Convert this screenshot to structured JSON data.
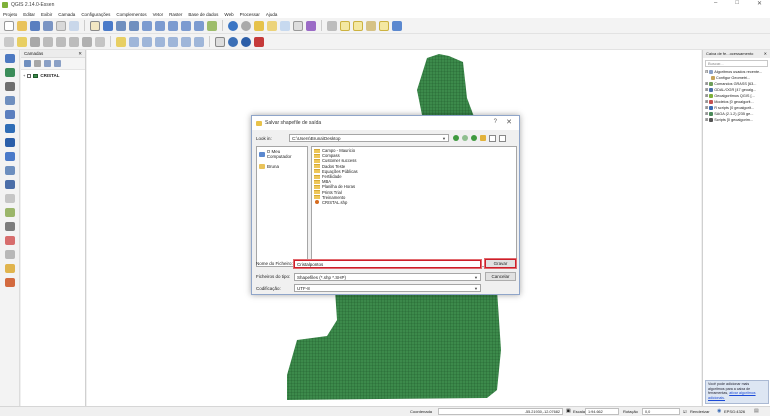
{
  "window": {
    "title": "QGIS 2.14.0-Essen",
    "controls": [
      "–",
      "□",
      "✕"
    ]
  },
  "menu": [
    "Projeto",
    "Editar",
    "Exibir",
    "Camada",
    "Configurações",
    "Complementos",
    "Vetor",
    "Raster",
    "Base de dados",
    "Web",
    "Processar",
    "Ajuda"
  ],
  "layers_panel": {
    "title": "Camadas",
    "layers": [
      {
        "name": "CRISTAL"
      }
    ]
  },
  "toolbox": {
    "title": "Caixa de fe...ocessamento",
    "search_placeholder": "Buscar...",
    "items": [
      "Algoritmos usados recente...",
      "Configur Geometri...",
      "Comandos GRASS [63...",
      "GDAL/OGR [47 geoalg...",
      "Geoalgoritmos QGIS [...",
      "Modelos [0 geoalgorit...",
      "R scripts [0 geoalgorit...",
      "SAGA (2.1.2) [235 ge...",
      "Scripts [0 geoalgorim..."
    ],
    "note_text": "Você pode adicionar mais algoritmos para a caixa de ferramentas,",
    "note_link": "ativar algoritmos adicionais."
  },
  "dialog": {
    "title": "Salvar shapefile de saída",
    "help_glyph": "?",
    "close_glyph": "✕",
    "lookin_label": "Look in:",
    "lookin_path": "C:\\Users\\Bruna\\Desktop",
    "sidebar": [
      {
        "label": "O Meu Computador"
      },
      {
        "label": "Bruna"
      }
    ],
    "entries": [
      {
        "name": "Campo - Mauricio",
        "kind": "folder"
      },
      {
        "name": "Compass",
        "kind": "folder"
      },
      {
        "name": "Customer success",
        "kind": "folder"
      },
      {
        "name": "Dados Teste",
        "kind": "folder"
      },
      {
        "name": "Equações Públicas",
        "kind": "folder"
      },
      {
        "name": "Fertilidade",
        "kind": "folder"
      },
      {
        "name": "MBA",
        "kind": "folder"
      },
      {
        "name": "Planilha de Horas",
        "kind": "folder"
      },
      {
        "name": "Prints Trial",
        "kind": "folder"
      },
      {
        "name": "Treinamento",
        "kind": "folder"
      },
      {
        "name": "CRISTAL.shp",
        "kind": "file"
      }
    ],
    "filename_label": "Nome do Ficheiro:",
    "filename_value": "Cristalpontos",
    "save_button": "Gravar",
    "filetype_label": "Ficheiros do tipo:",
    "filetype_value": "Shapefiles (*.shp *.SHP)",
    "cancel_button": "Cancelar",
    "encoding_label": "Codificação:",
    "encoding_value": "UTF-8"
  },
  "statusbar": {
    "coord_label": "Coordenada",
    "coord_value": "-55.21930,-12.07682",
    "scale_label": "Escala",
    "scale_value": "1:94.662",
    "rotation_label": "Rotação",
    "rotation_value": "0,0",
    "render_label": "Renderizar",
    "crs_label": "EPSG:4326"
  },
  "colors": {
    "map_fill": "#3c8a4b",
    "map_grid": "#1f5a2a",
    "highlight": "#cc1f2a",
    "note_bg": "#dde6f3"
  }
}
